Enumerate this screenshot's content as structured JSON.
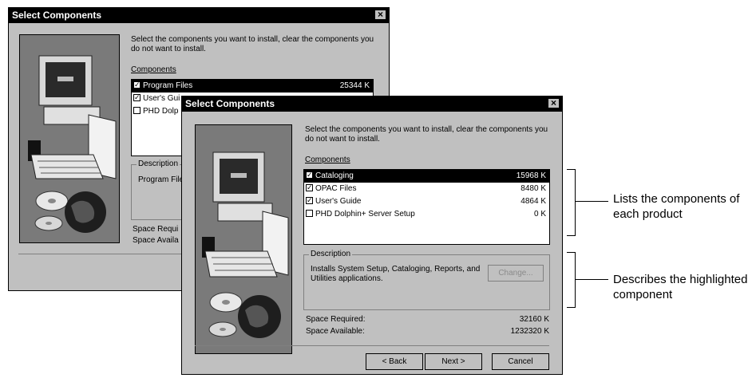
{
  "back_dialog": {
    "title": "Select Components",
    "instructions": "Select the components you want to install, clear the components you do not want to install.",
    "components_label": "Components",
    "components": [
      {
        "label": "Program Files",
        "size": "25344 K",
        "checked": true,
        "selected": true
      },
      {
        "label": "User's Gui",
        "size": "",
        "checked": true,
        "selected": false
      },
      {
        "label": "PHD Dolp",
        "size": "",
        "checked": false,
        "selected": false
      }
    ],
    "description_label": "Description",
    "description_text": "Program File",
    "space_required_label": "Space Requi",
    "space_available_label": "Space Availa"
  },
  "front_dialog": {
    "title": "Select Components",
    "instructions": "Select the components you want to install, clear the components you do not want to install.",
    "components_label": "Components",
    "components": [
      {
        "label": "Cataloging",
        "size": "15968 K",
        "checked": true,
        "selected": true
      },
      {
        "label": "OPAC Files",
        "size": "8480 K",
        "checked": true,
        "selected": false
      },
      {
        "label": "User's Guide",
        "size": "4864 K",
        "checked": true,
        "selected": false
      },
      {
        "label": "PHD Dolphin+ Server Setup",
        "size": "0 K",
        "checked": false,
        "selected": false
      }
    ],
    "description_label": "Description",
    "description_text": "Installs System Setup, Cataloging, Reports, and Utilities applications.",
    "change_button": "Change...",
    "space_required_label": "Space Required:",
    "space_required_value": "32160 K",
    "space_available_label": "Space Available:",
    "space_available_value": "1232320 K",
    "back_button": "< Back",
    "next_button": "Next >",
    "cancel_button": "Cancel"
  },
  "annotations": {
    "components_note": "Lists the components of each product",
    "description_note": "Describes the highlighted component"
  }
}
